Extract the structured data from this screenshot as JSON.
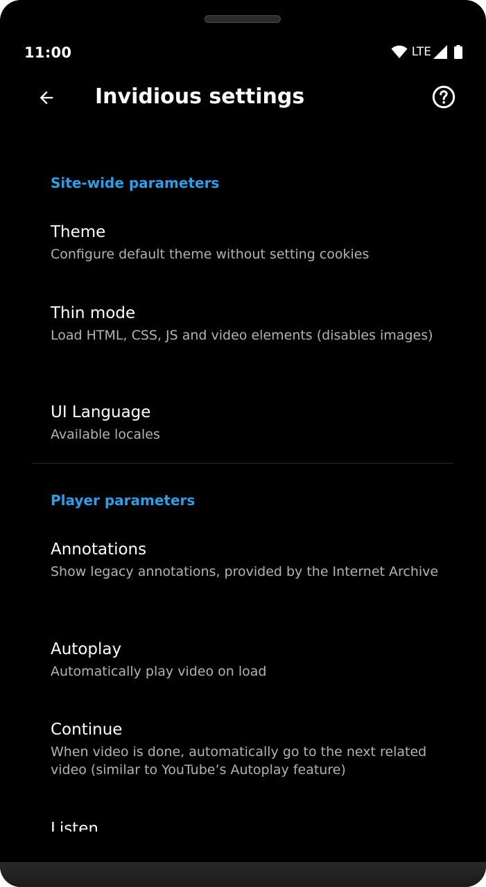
{
  "status_bar": {
    "time": "11:00",
    "network": "LTE",
    "icons": [
      "wifi-icon",
      "signal-icon",
      "battery-icon"
    ]
  },
  "app_bar": {
    "title": "Invidious settings",
    "back_icon": "arrow-back-icon",
    "help_icon": "help-circle-icon"
  },
  "colors": {
    "background": "#000000",
    "accent": "#2f9ee8",
    "title_text": "#ffffff",
    "summary_text": "#b3b3b3",
    "divider": "#2c2c2c"
  },
  "sections": [
    {
      "header": "Site-wide parameters",
      "items": [
        {
          "title": "Theme",
          "summary": "Configure default theme without setting cookies"
        },
        {
          "title": "Thin mode",
          "summary": "Load HTML, CSS, JS and video elements (disables images)"
        },
        {
          "title": "UI Language",
          "summary": "Available locales"
        }
      ]
    },
    {
      "header": "Player parameters",
      "items": [
        {
          "title": "Annotations",
          "summary": "Show legacy annotations, provided by the Internet Archive"
        },
        {
          "title": "Autoplay",
          "summary": "Automatically play video on load"
        },
        {
          "title": "Continue",
          "summary": "When video is done, automatically go to the next related video (similar to YouTube’s Autoplay feature)"
        },
        {
          "title": "Listen",
          "summary": ""
        }
      ]
    }
  ]
}
